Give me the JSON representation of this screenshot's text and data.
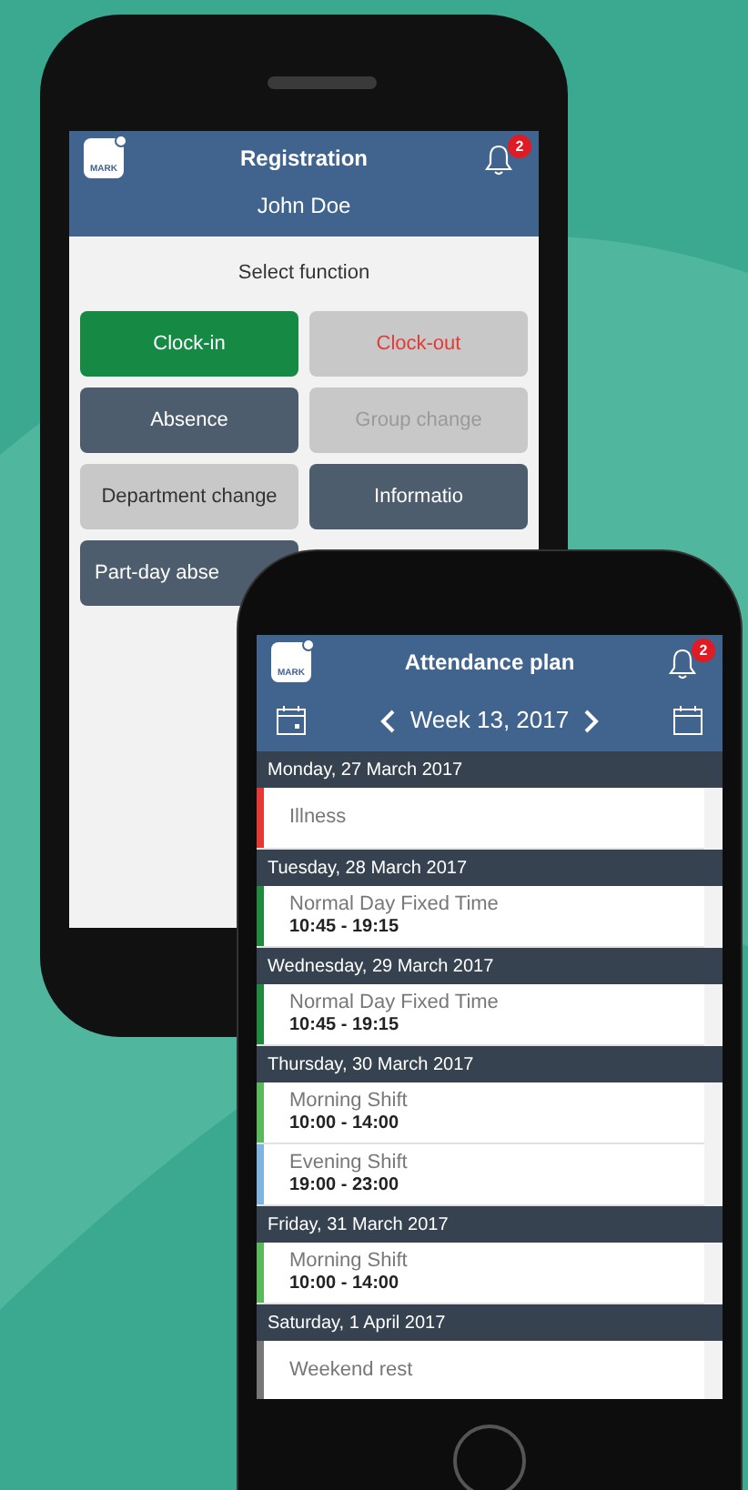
{
  "back_phone": {
    "logo": "MARK",
    "title": "Registration",
    "notification_count": "2",
    "user": "John Doe",
    "prompt": "Select function",
    "buttons": [
      {
        "label": "Clock-in",
        "kind": "primary"
      },
      {
        "label": "Clock-out",
        "kind": "danger"
      },
      {
        "label": "Absence",
        "kind": "dark"
      },
      {
        "label": "Group change",
        "kind": "disabled"
      },
      {
        "label": "Department change",
        "kind": "light"
      },
      {
        "label": "Informatio",
        "kind": "dark"
      },
      {
        "label": "Part-day abse",
        "kind": "dark"
      }
    ]
  },
  "front_phone": {
    "logo": "MARK",
    "title": "Attendance plan",
    "notification_count": "2",
    "week": "Week 13, 2017",
    "days": [
      {
        "date": "Monday, 27 March 2017",
        "entries": [
          {
            "name": "Illness",
            "color": "#e53935"
          }
        ]
      },
      {
        "date": "Tuesday, 28 March 2017",
        "entries": [
          {
            "name": "Normal Day Fixed Time",
            "time": "10:45 - 19:15",
            "color": "#1e8a3e"
          }
        ]
      },
      {
        "date": "Wednesday, 29 March 2017",
        "entries": [
          {
            "name": "Normal Day Fixed Time",
            "time": "10:45 - 19:15",
            "color": "#1e8a3e"
          }
        ]
      },
      {
        "date": "Thursday, 30 March 2017",
        "entries": [
          {
            "name": "Morning Shift",
            "time": "10:00 - 14:00",
            "color": "#5cb85c"
          },
          {
            "name": "Evening Shift",
            "time": "19:00 - 23:00",
            "color": "#7fb3e0"
          }
        ]
      },
      {
        "date": "Friday, 31 March 2017",
        "entries": [
          {
            "name": "Morning Shift",
            "time": "10:00 - 14:00",
            "color": "#5cb85c"
          }
        ]
      },
      {
        "date": "Saturday, 1 April 2017",
        "entries": [
          {
            "name": "Weekend rest",
            "color": "#777777"
          }
        ]
      }
    ]
  }
}
